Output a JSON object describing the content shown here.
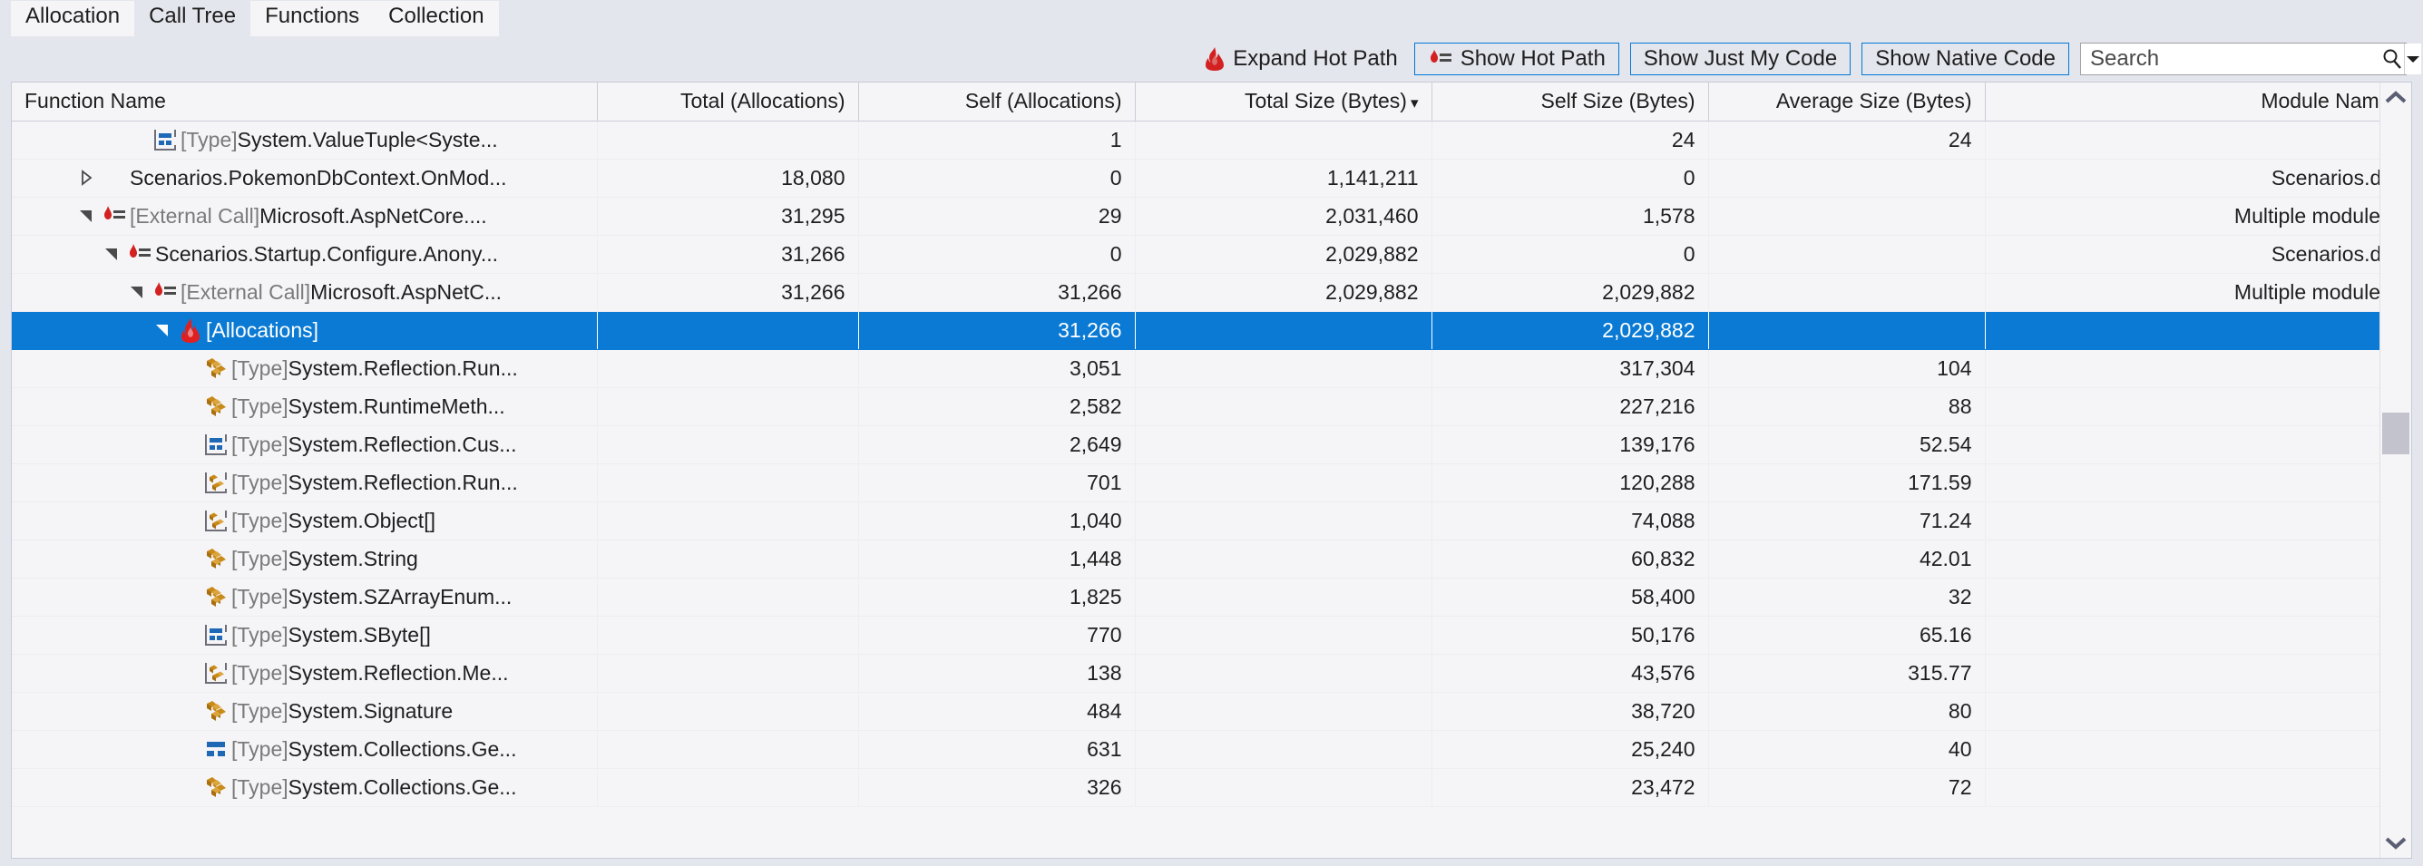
{
  "tabs": [
    {
      "label": "Allocation",
      "active": false
    },
    {
      "label": "Call Tree",
      "active": true
    },
    {
      "label": "Functions",
      "active": false
    },
    {
      "label": "Collection",
      "active": false
    }
  ],
  "toolbar": {
    "expand_hot_path": "Expand Hot Path",
    "show_hot_path": "Show Hot Path",
    "show_just_my_code": "Show Just My Code",
    "show_native_code": "Show Native Code",
    "search_placeholder": "Search",
    "search_value": "",
    "accent_color": "#0078d7",
    "flame_color": "#d32020"
  },
  "grid": {
    "columns": [
      {
        "label": "Function Name",
        "align": "left",
        "sorted": false
      },
      {
        "label": "Total (Allocations)",
        "align": "right",
        "sorted": false
      },
      {
        "label": "Self (Allocations)",
        "align": "right",
        "sorted": false
      },
      {
        "label": "Total Size (Bytes)",
        "align": "right",
        "sorted": true,
        "sort_dir": "desc"
      },
      {
        "label": "Self Size (Bytes)",
        "align": "right",
        "sorted": false
      },
      {
        "label": "Average Size (Bytes)",
        "align": "right",
        "sorted": false
      },
      {
        "label": "Module Name",
        "align": "right",
        "sorted": false
      }
    ],
    "sort_glyph": "▾",
    "selection_color": "#0a7ad4",
    "rows": [
      {
        "indent": 4,
        "twisty": "none",
        "icon": "struct-type-icon",
        "prefix": "[Type]",
        "name": "System.ValueTuple<Syste...",
        "total_allocations": "",
        "self_allocations": "1",
        "total_size": "",
        "self_size": "24",
        "average_size": "24",
        "module": "",
        "selected": false
      },
      {
        "indent": 2,
        "twisty": "collapsed",
        "icon": "none",
        "prefix": "",
        "name": "Scenarios.PokemonDbContext.OnMod...",
        "total_allocations": "18,080",
        "self_allocations": "0",
        "total_size": "1,141,211",
        "self_size": "0",
        "average_size": "",
        "module": "Scenarios.dll",
        "selected": false
      },
      {
        "indent": 2,
        "twisty": "expanded",
        "icon": "hotpath-call-icon",
        "prefix": "[External Call]",
        "name": "Microsoft.AspNetCore....",
        "total_allocations": "31,295",
        "self_allocations": "29",
        "total_size": "2,031,460",
        "self_size": "1,578",
        "average_size": "",
        "module": "Multiple modules",
        "selected": false
      },
      {
        "indent": 3,
        "twisty": "expanded",
        "icon": "hotpath-call-icon",
        "prefix": "",
        "name": "Scenarios.Startup.Configure.Anony...",
        "total_allocations": "31,266",
        "self_allocations": "0",
        "total_size": "2,029,882",
        "self_size": "0",
        "average_size": "",
        "module": "Scenarios.dll",
        "selected": false
      },
      {
        "indent": 4,
        "twisty": "expanded",
        "icon": "hotpath-call-icon",
        "prefix": "[External Call]",
        "name": "Microsoft.AspNetC...",
        "total_allocations": "31,266",
        "self_allocations": "31,266",
        "total_size": "2,029,882",
        "self_size": "2,029,882",
        "average_size": "",
        "module": "Multiple modules",
        "selected": false
      },
      {
        "indent": 5,
        "twisty": "expanded",
        "icon": "flame-icon",
        "prefix": "",
        "name": "[Allocations]",
        "total_allocations": "",
        "self_allocations": "31,266",
        "total_size": "",
        "self_size": "2,029,882",
        "average_size": "",
        "module": "",
        "selected": true
      },
      {
        "indent": 6,
        "twisty": "none",
        "icon": "class-type-icon",
        "prefix": "[Type]",
        "name": "System.Reflection.Run...",
        "total_allocations": "",
        "self_allocations": "3,051",
        "total_size": "",
        "self_size": "317,304",
        "average_size": "104",
        "module": "",
        "selected": false
      },
      {
        "indent": 6,
        "twisty": "none",
        "icon": "class-type-icon",
        "prefix": "[Type]",
        "name": "System.RuntimeMeth...",
        "total_allocations": "",
        "self_allocations": "2,582",
        "total_size": "",
        "self_size": "227,216",
        "average_size": "88",
        "module": "",
        "selected": false
      },
      {
        "indent": 6,
        "twisty": "none",
        "icon": "struct-type-icon",
        "prefix": "[Type]",
        "name": "System.Reflection.Cus...",
        "total_allocations": "",
        "self_allocations": "2,649",
        "total_size": "",
        "self_size": "139,176",
        "average_size": "52.54",
        "module": "",
        "selected": false
      },
      {
        "indent": 6,
        "twisty": "none",
        "icon": "internal-class-type-icon",
        "prefix": "[Type]",
        "name": "System.Reflection.Run...",
        "total_allocations": "",
        "self_allocations": "701",
        "total_size": "",
        "self_size": "120,288",
        "average_size": "171.59",
        "module": "",
        "selected": false
      },
      {
        "indent": 6,
        "twisty": "none",
        "icon": "internal-class-type-icon",
        "prefix": "[Type]",
        "name": "System.Object[]",
        "total_allocations": "",
        "self_allocations": "1,040",
        "total_size": "",
        "self_size": "74,088",
        "average_size": "71.24",
        "module": "",
        "selected": false
      },
      {
        "indent": 6,
        "twisty": "none",
        "icon": "class-type-icon",
        "prefix": "[Type]",
        "name": "System.String",
        "total_allocations": "",
        "self_allocations": "1,448",
        "total_size": "",
        "self_size": "60,832",
        "average_size": "42.01",
        "module": "",
        "selected": false
      },
      {
        "indent": 6,
        "twisty": "none",
        "icon": "class-type-icon",
        "prefix": "[Type]",
        "name": "System.SZArrayEnum...",
        "total_allocations": "",
        "self_allocations": "1,825",
        "total_size": "",
        "self_size": "58,400",
        "average_size": "32",
        "module": "",
        "selected": false
      },
      {
        "indent": 6,
        "twisty": "none",
        "icon": "struct-type-icon",
        "prefix": "[Type]",
        "name": "System.SByte[]",
        "total_allocations": "",
        "self_allocations": "770",
        "total_size": "",
        "self_size": "50,176",
        "average_size": "65.16",
        "module": "",
        "selected": false
      },
      {
        "indent": 6,
        "twisty": "none",
        "icon": "internal-class-type-icon",
        "prefix": "[Type]",
        "name": "System.Reflection.Me...",
        "total_allocations": "",
        "self_allocations": "138",
        "total_size": "",
        "self_size": "43,576",
        "average_size": "315.77",
        "module": "",
        "selected": false
      },
      {
        "indent": 6,
        "twisty": "none",
        "icon": "class-type-icon",
        "prefix": "[Type]",
        "name": "System.Signature",
        "total_allocations": "",
        "self_allocations": "484",
        "total_size": "",
        "self_size": "38,720",
        "average_size": "80",
        "module": "",
        "selected": false
      },
      {
        "indent": 6,
        "twisty": "none",
        "icon": "struct-plain-type-icon",
        "prefix": "[Type]",
        "name": "System.Collections.Ge...",
        "total_allocations": "",
        "self_allocations": "631",
        "total_size": "",
        "self_size": "25,240",
        "average_size": "40",
        "module": "",
        "selected": false
      },
      {
        "indent": 6,
        "twisty": "none",
        "icon": "class-type-icon",
        "prefix": "[Type]",
        "name": "System.Collections.Ge...",
        "total_allocations": "",
        "self_allocations": "326",
        "total_size": "",
        "self_size": "23,472",
        "average_size": "72",
        "module": "",
        "selected": false
      }
    ]
  },
  "scrollbar": {
    "up_icon": "chevron-up-icon",
    "down_icon": "chevron-down-icon"
  }
}
